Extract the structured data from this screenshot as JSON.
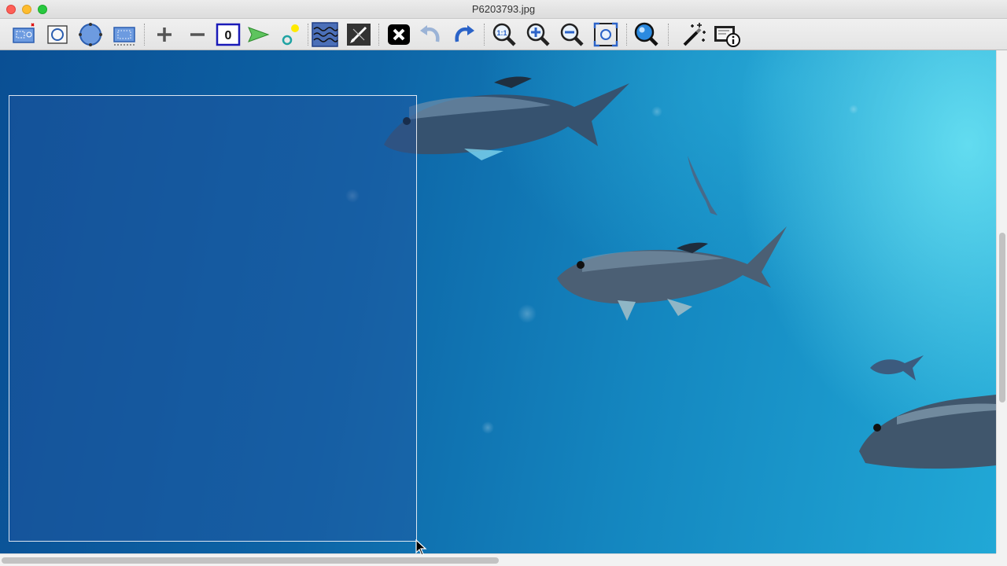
{
  "window": {
    "title": "P6203793.jpg"
  },
  "toolbar": {
    "zero_label": "0",
    "one_to_one_label": "1:1",
    "tools": [
      "add-roi-rectangle-icon",
      "oval-roi-icon",
      "polygon-roi-icon",
      "dotted-roi-icon",
      "plus-icon",
      "minus-icon",
      "zero-icon",
      "play-arrow-icon",
      "point-marker-icon",
      "waveform-icon",
      "pen-edit-icon",
      "close-x-icon",
      "undo-icon",
      "redo-icon",
      "zoom-one-to-one-icon",
      "zoom-in-icon",
      "zoom-out-icon",
      "zoom-fit-icon",
      "zoom-region-icon",
      "magic-wand-icon",
      "image-info-icon"
    ]
  },
  "colors": {
    "accent": "#2a5db0",
    "water_dark": "#0a4f94",
    "water_light": "#21a8d6"
  }
}
